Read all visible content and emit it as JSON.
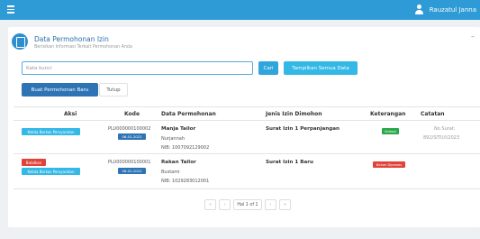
{
  "topbar": {
    "user_name": "Rauzatul Janna"
  },
  "panel": {
    "title": "Data Permohonan Izin",
    "subtitle": "Berisikan Informasi Terkait Permohonan Anda",
    "collapse_symbol": "–"
  },
  "search": {
    "placeholder": "Kata kunci",
    "cari_label": "Cari",
    "show_all_label": "Tampilkan Semua Data"
  },
  "actions": {
    "create_label": "Buat Permohonan Baru",
    "close_label": "Tutup"
  },
  "table": {
    "headers": [
      "Aksi",
      "Kode",
      "Data Permohonan",
      "Jenis Izin Dimohon",
      "Keterangan",
      "Catatan"
    ],
    "rows": [
      {
        "buttons": [
          {
            "label": "Kelola Berkas Persyaratan",
            "color": "#34b8e6"
          }
        ],
        "kode": "PLU000000100002",
        "date": "06-02-2022",
        "name": "Manja Tailor",
        "owner": "Nurjannah",
        "nib": "NIB: 1007092129002",
        "jenis": "Surat Izin 1 Perpanjangan",
        "status": "Selesai",
        "status_color": "#2aa84a",
        "catatan_line1": "No Surat:",
        "catatan_line2": "892/SITU/I/2023"
      },
      {
        "buttons": [
          {
            "label": "Batalkan",
            "color": "#e0433a"
          },
          {
            "label": "Kelola Berkas Persyaratan",
            "color": "#34b8e6"
          }
        ],
        "kode": "PLU000000100001",
        "date": "06-02-2022",
        "name": "Rakan Tailor",
        "owner": "Bustami",
        "nib": "NIB: 1029283012001",
        "jenis": "Surat Izin 1 Baru",
        "status": "Belum Diproses",
        "status_color": "#e0433a",
        "catatan_line1": "",
        "catatan_line2": ""
      }
    ]
  },
  "pagination": {
    "first": "«",
    "prev": "‹",
    "info": "Hal 1 of 1",
    "next": "›",
    "last": "»"
  }
}
